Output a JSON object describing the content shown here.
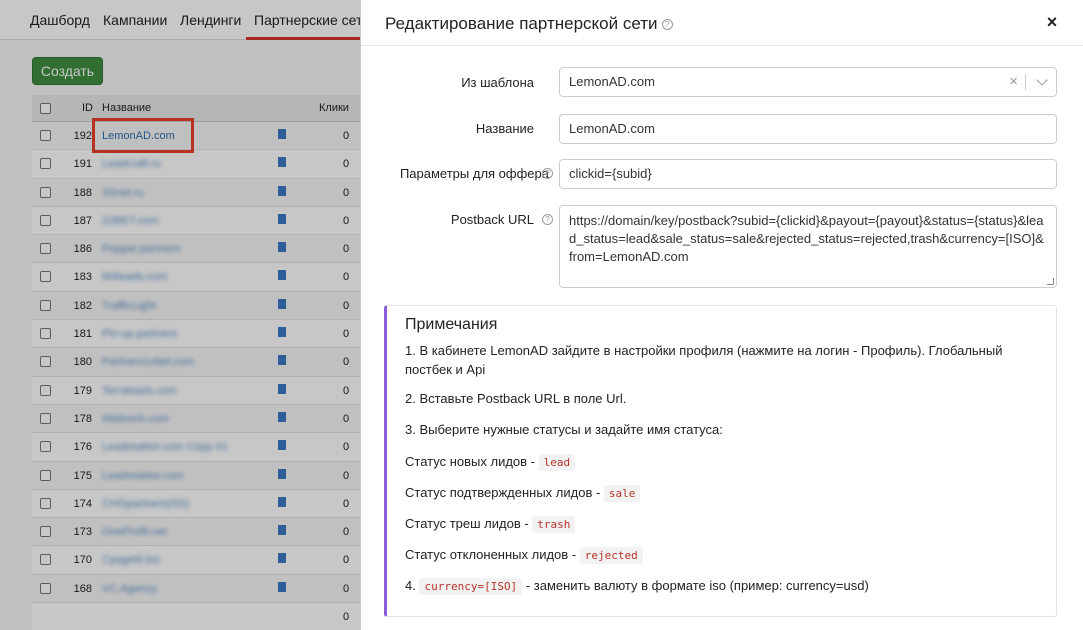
{
  "nav": {
    "items": [
      "Дашборд",
      "Кампании",
      "Лендинги",
      "Партнерские сети"
    ]
  },
  "toolbar": {
    "create_label": "Создать"
  },
  "table": {
    "headers": {
      "id": "ID",
      "name": "Название",
      "clicks": "Клики"
    },
    "rows": [
      {
        "id": "192",
        "name": "LemonAD.com",
        "clicks": "0"
      },
      {
        "id": "191",
        "name": "Leadcraft.ru",
        "clicks": "0"
      },
      {
        "id": "188",
        "name": "3Snet.ru",
        "clicks": "0"
      },
      {
        "id": "187",
        "name": "22BET.com",
        "clicks": "0"
      },
      {
        "id": "186",
        "name": "Pepper.partners",
        "clicks": "0"
      },
      {
        "id": "183",
        "name": "M4leads.com",
        "clicks": "0"
      },
      {
        "id": "182",
        "name": "TrafficLight",
        "clicks": "0"
      },
      {
        "id": "181",
        "name": "Pin-up.partners",
        "clicks": "0"
      },
      {
        "id": "180",
        "name": "Partners1xbet.com",
        "clicks": "0"
      },
      {
        "id": "179",
        "name": "Terraleads.com",
        "clicks": "0"
      },
      {
        "id": "178",
        "name": "Webvork.com",
        "clicks": "0"
      },
      {
        "id": "176",
        "name": "Leadreaktor.com Copy #1",
        "clicks": "0"
      },
      {
        "id": "175",
        "name": "Leadreaktor.com",
        "clicks": "0"
      },
      {
        "id": "174",
        "name": "CHGpartners(SS)",
        "clicks": "0"
      },
      {
        "id": "173",
        "name": "OneProfit.net",
        "clicks": "0"
      },
      {
        "id": "170",
        "name": "Cpagetti.biz",
        "clicks": "0"
      },
      {
        "id": "168",
        "name": "VC.Agency",
        "clicks": "0"
      }
    ],
    "footer_clicks": "0"
  },
  "modal": {
    "title": "Редактирование партнерской сети",
    "close_symbol": "×",
    "template_label": "Из шаблона",
    "template_value": "LemonAD.com",
    "clear_symbol": "×",
    "name_label": "Название",
    "name_value": "LemonAD.com",
    "offer_params_label": "Параметры для оффера",
    "offer_params_value": "clickid={subid}",
    "postback_label": "Postback URL",
    "postback_value": "https://domain/key/postback?subid={clickid}&payout={payout}&status={status}&lead_status=lead&sale_status=sale&rejected_status=rejected,trash&currency=[ISO]&from=LemonAD.com"
  },
  "notes": {
    "title": "Примечания",
    "line1a": "1. В кабинете LemonAD зайдите в настройки профиля (нажмите на логин - Профиль). Глобальный",
    "line1b": "постбек и Api",
    "line2": "2. Вставьте Postback URL в поле Url.",
    "line3": "3. Выберите нужные статусы и задайте имя статуса:",
    "status_new_label": "Статус новых лидов -",
    "status_new_code": "lead",
    "status_confirmed_label": "Статус подтвержденных лидов -",
    "status_confirmed_code": "sale",
    "status_trash_label": "Статус треш лидов -",
    "status_trash_code": "trash",
    "status_rejected_label": "Статус отклоненных лидов -",
    "status_rejected_code": "rejected",
    "line4_prefix": "4.",
    "line4_code": "currency=[ISO]",
    "line4_text": "- заменить валюту в формате iso (пример: currency=usd)"
  },
  "colors": {
    "accent_purple": "#8b5fd6",
    "create_green": "#3e8e41",
    "highlight_red": "#e8402a",
    "code_red": "#b8332a"
  },
  "icons": {
    "help": "question-circle-icon",
    "close": "close-icon",
    "doc": "document-icon",
    "chevron": "chevron-down-icon"
  }
}
